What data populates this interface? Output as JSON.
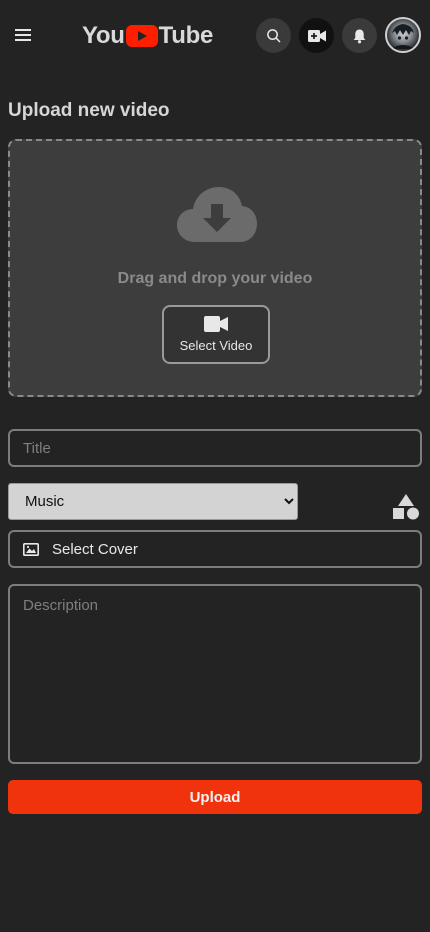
{
  "header": {
    "logo_left": "You",
    "logo_right": "Tube",
    "icons": [
      "menu-icon",
      "search-icon",
      "video-camera-icon",
      "bell-icon",
      "avatar"
    ]
  },
  "upload": {
    "page_title": "Upload new video",
    "drop_text": "Drag and drop your video",
    "select_video_label": "Select Video"
  },
  "form": {
    "title_placeholder": "Title",
    "category_selected": "Music",
    "category_options": [
      "Music"
    ],
    "cover_label": "Select Cover",
    "description_placeholder": "Description",
    "upload_label": "Upload"
  },
  "colors": {
    "background": "#232323",
    "accent": "#f0320d",
    "logo_red": "#ff1e00"
  }
}
